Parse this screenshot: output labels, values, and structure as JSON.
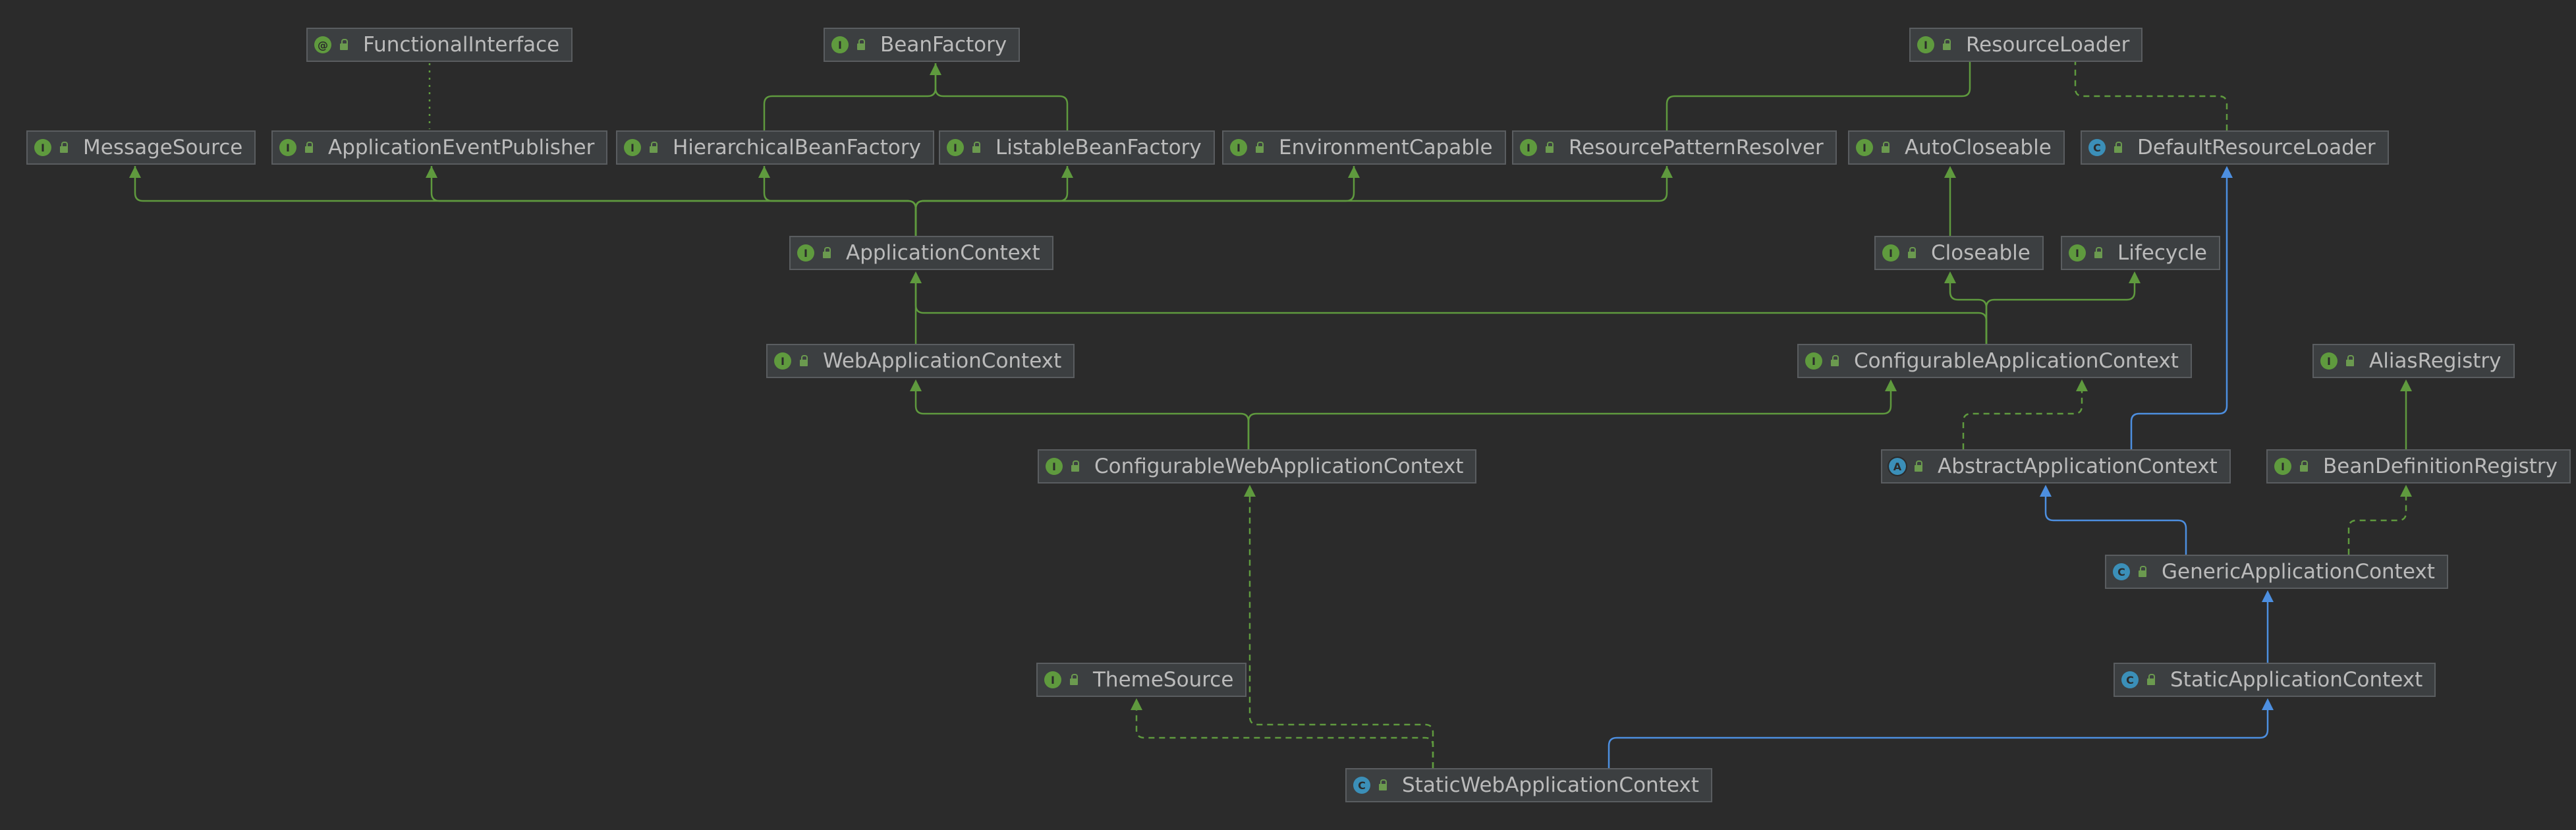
{
  "nodes": {
    "functional_interface": {
      "name": "FunctionalInterface",
      "kind": "@"
    },
    "bean_factory": {
      "name": "BeanFactory",
      "kind": "I"
    },
    "resource_loader": {
      "name": "ResourceLoader",
      "kind": "I"
    },
    "message_source": {
      "name": "MessageSource",
      "kind": "I"
    },
    "application_event_publisher": {
      "name": "ApplicationEventPublisher",
      "kind": "I"
    },
    "hierarchical_bean_factory": {
      "name": "HierarchicalBeanFactory",
      "kind": "I"
    },
    "listable_bean_factory": {
      "name": "ListableBeanFactory",
      "kind": "I"
    },
    "environment_capable": {
      "name": "EnvironmentCapable",
      "kind": "I"
    },
    "resource_pattern_resolver": {
      "name": "ResourcePatternResolver",
      "kind": "I"
    },
    "auto_closeable": {
      "name": "AutoCloseable",
      "kind": "I"
    },
    "default_resource_loader": {
      "name": "DefaultResourceLoader",
      "kind": "C"
    },
    "application_context": {
      "name": "ApplicationContext",
      "kind": "I"
    },
    "closeable": {
      "name": "Closeable",
      "kind": "I"
    },
    "lifecycle": {
      "name": "Lifecycle",
      "kind": "I"
    },
    "web_application_context": {
      "name": "WebApplicationContext",
      "kind": "I"
    },
    "configurable_application_context": {
      "name": "ConfigurableApplicationContext",
      "kind": "I"
    },
    "alias_registry": {
      "name": "AliasRegistry",
      "kind": "I"
    },
    "configurable_web_application_context": {
      "name": "ConfigurableWebApplicationContext",
      "kind": "I"
    },
    "abstract_application_context": {
      "name": "AbstractApplicationContext",
      "kind": "A"
    },
    "bean_definition_registry": {
      "name": "BeanDefinitionRegistry",
      "kind": "I"
    },
    "generic_application_context": {
      "name": "GenericApplicationContext",
      "kind": "C"
    },
    "theme_source": {
      "name": "ThemeSource",
      "kind": "I"
    },
    "static_application_context": {
      "name": "StaticApplicationContext",
      "kind": "C"
    },
    "static_web_application_context": {
      "name": "StaticWebApplicationContext",
      "kind": "C"
    }
  },
  "colors": {
    "background": "#2b2b2b",
    "node_fill": "#3c3f41",
    "node_border": "#5a5d60",
    "text": "#bbbbbb",
    "interface_badge": "#5f9a3e",
    "class_badge": "#3b8fb8",
    "interface_edge": "#5f9a3e",
    "class_edge": "#4d8fe0"
  }
}
